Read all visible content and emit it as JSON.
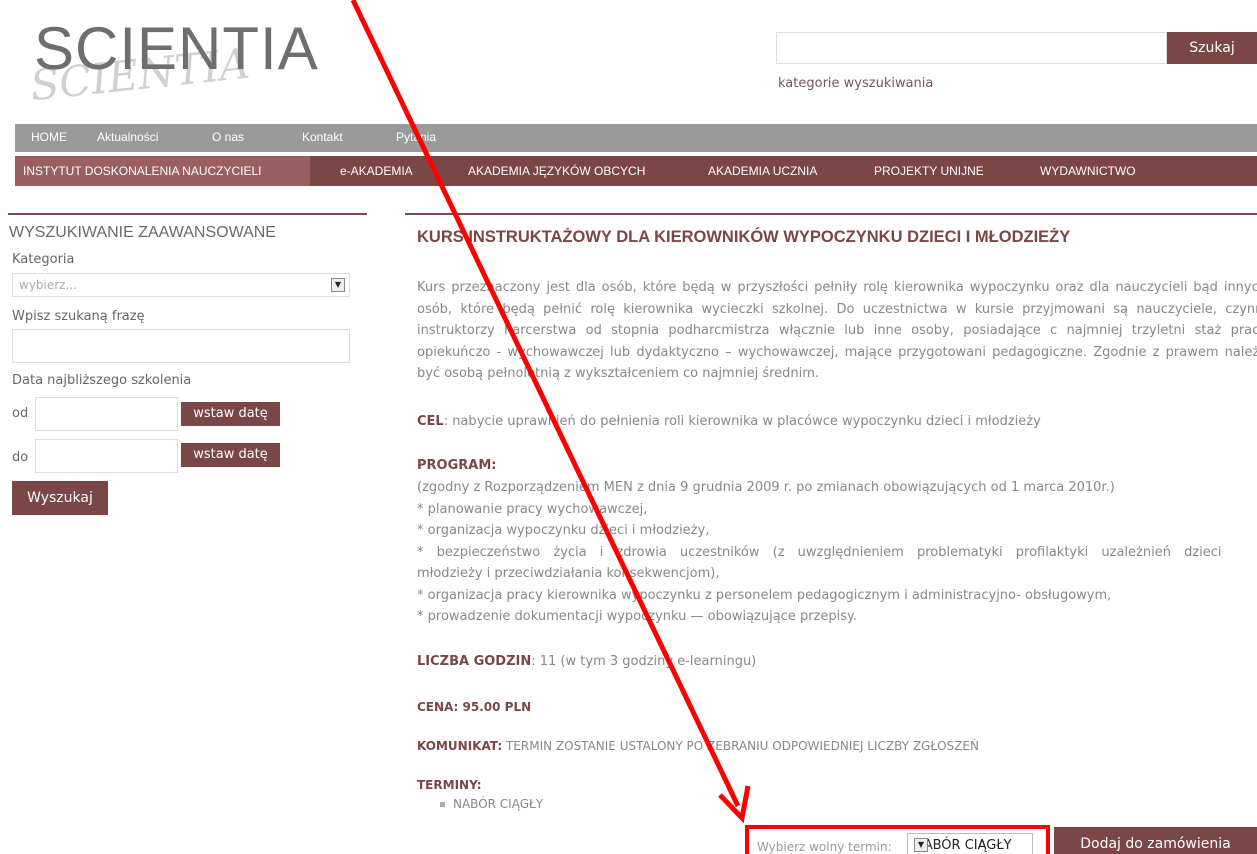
{
  "header": {
    "logo_text": "SCIENTIA",
    "search_placeholder": "",
    "search_button": "Szukaj",
    "search_categories": "kategorie wyszukiwania"
  },
  "topnav": [
    "HOME",
    "Aktualności",
    "O nas",
    "Kontakt",
    "Pytania"
  ],
  "subnav": [
    "INSTYTUT DOSKONALENIA NAUCZYCIELI",
    "e-AKADEMIA",
    "AKADEMIA JĘZYKÓW OBCYCH",
    "AKADEMIA UCZNIA",
    "PROJEKTY UNIJNE",
    "WYDAWNICTWO"
  ],
  "sidebar": {
    "title": "WYSZUKIWANIE ZAAWANSOWANE",
    "category_label": "Kategoria",
    "category_placeholder": "wybierz...",
    "phrase_label": "Wpisz szukaną frazę",
    "date_label": "Data najbliższego szkolenia",
    "from_label": "od",
    "to_label": "do",
    "date_button": "wstaw datę",
    "search_button": "Wyszukaj"
  },
  "course": {
    "title": "KURS INSTRUKTAŻOWY DLA KIEROWNIKÓW WYPOCZYNKU DZIECI I MŁODZIEŻY",
    "description": "Kurs przeznaczony jest dla osób, które będą w przyszłości pełniły rolę kierownika wypoczynku oraz dla nauczycieli bąd innych osób, które będą pełnić rolę kierownika wycieczki szkolnej. Do uczestnictwa w kursie przyjmowani są nauczyciele, czynni instruktorzy harcerstwa od stopnia podharcmistrza włącznie lub inne osoby, posiadające c najmniej trzyletni staż pracy opiekuńczo - wychowawczej lub dydaktyczno – wychowawczej, mające przygotowani pedagogiczne. Zgodnie z prawem należy być osobą pełnoletnią z wykształceniem co najmniej średnim.",
    "goal_label": "CEL",
    "goal_text": ": nabycie uprawnień do pełnienia roli kierownika w placówce wypoczynku dzieci i młodzieży",
    "program_label": "PROGRAM",
    "program_colon": ":",
    "program_lines": [
      "(zgodny z Rozporządzeniem MEN z dnia 9 grudnia 2009 r. po zmianach obowiązujących od 1 marca 2010r.)",
      "* planowanie pracy wychowawczej,",
      "* organizacja wypoczynku dzieci i młodzieży,",
      "* bezpieczeństwo życia i zdrowia uczestników (z uwzględnieniem problematyki profilaktyki uzależnień dzieci",
      "młodzieży i przeciwdziałania konsekwencjom),",
      "* organizacja pracy kierownika wypoczynku z personelem pedagogicznym i administracyjno- obsługowym,",
      "* prowadzenie dokumentacji wypoczynku — obowiązujące przepisy."
    ],
    "hours_label": "LICZBA GODZIN",
    "hours_text": ": 11 (w tym 3 godziny e-learningu)",
    "price": "CENA: 95.00 PLN",
    "notice_label": "KOMUNIKAT:",
    "notice_text": "TERMIN ZOSTANIE USTALONY PO ZEBRANIU ODPOWIEDNIEJ LICZBY ZGŁOSZEŃ",
    "terms_label": "TERMINY:",
    "terms": [
      "NABÓR CIĄGŁY"
    ]
  },
  "order": {
    "label": "Wybierz wolny termin:",
    "selected": "NABÓR CIĄGŁY",
    "button": "Dodaj do zamówienia"
  },
  "colors": {
    "brand": "#7b4646",
    "nav_gray": "#9a9a9a",
    "annotation": "#ff0000"
  }
}
